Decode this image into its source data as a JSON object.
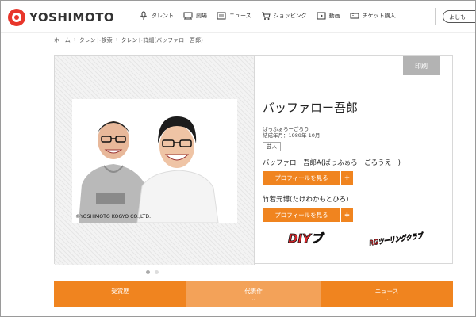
{
  "header": {
    "logo_text": "YOSHIMOTO",
    "nav": [
      {
        "label": "タレント",
        "icon": "microphone-icon"
      },
      {
        "label": "劇場",
        "icon": "theater-icon"
      },
      {
        "label": "ニュース",
        "icon": "news-icon"
      },
      {
        "label": "ショッピング",
        "icon": "cart-icon"
      },
      {
        "label": "動画",
        "icon": "video-icon"
      },
      {
        "label": "チケット購入",
        "icon": "ticket-icon"
      }
    ],
    "search_label": "よしも"
  },
  "breadcrumb": [
    "ホーム",
    "タレント検索",
    "タレント詳細(バッファロー吾郎)"
  ],
  "breadcrumb_sep": "›",
  "talent": {
    "name": "バッファロー吾郎",
    "reading": "ばっふぁろーごろう",
    "formed": "結成年月：1989年 10月",
    "category": "芸人",
    "photo_credit": "©YOSHIMOTO KOGYO CO.,LTD.",
    "members": [
      {
        "name": "バッファロー吾郎A(ばっふぁろーごろうえー)",
        "button": "プロフィールを見る"
      },
      {
        "name": "竹若元博(たけわかもとひろ)",
        "button": "プロフィールを見る"
      }
    ],
    "program_logos": [
      "DIYブ",
      "RGツーリングクラブ"
    ]
  },
  "print_label": "印刷",
  "plus_symbol": "+",
  "carousel": {
    "count": 2,
    "active": 0
  },
  "tabs": [
    {
      "label": "受賞歴",
      "active": false
    },
    {
      "label": "代表作",
      "active": true
    },
    {
      "label": "ニュース",
      "active": false
    }
  ],
  "chevron": "⌄",
  "colors": {
    "accent": "#f0841f",
    "accent_light": "#f3a259",
    "brand_red": "#e8362b",
    "print_gray": "#b3b3b3"
  }
}
